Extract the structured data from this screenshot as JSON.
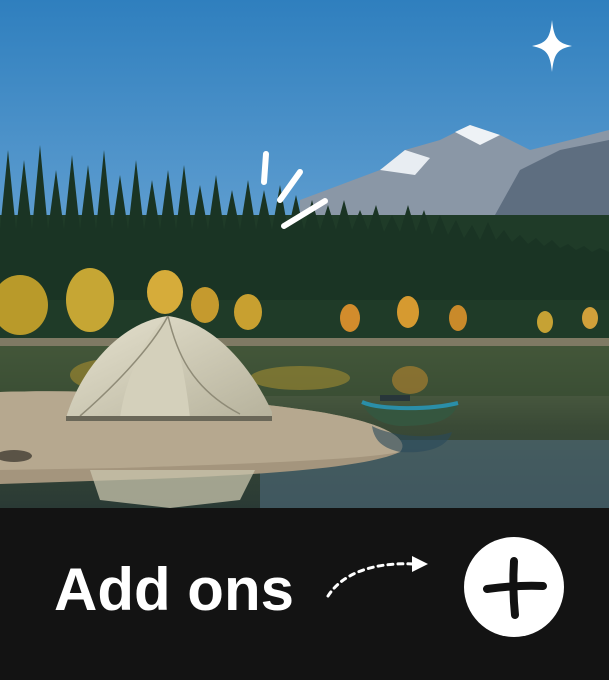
{
  "card": {
    "title": "Add ons",
    "add_button_label": "Add",
    "icons": {
      "sparkle": "sparkle-icon",
      "burst": "burst-lines-icon",
      "arrow": "dashed-arrow-icon",
      "plus": "plus-icon"
    },
    "colors": {
      "panel": "#131313",
      "text": "#ffffff",
      "button": "#ffffff",
      "plus": "#111111"
    }
  }
}
